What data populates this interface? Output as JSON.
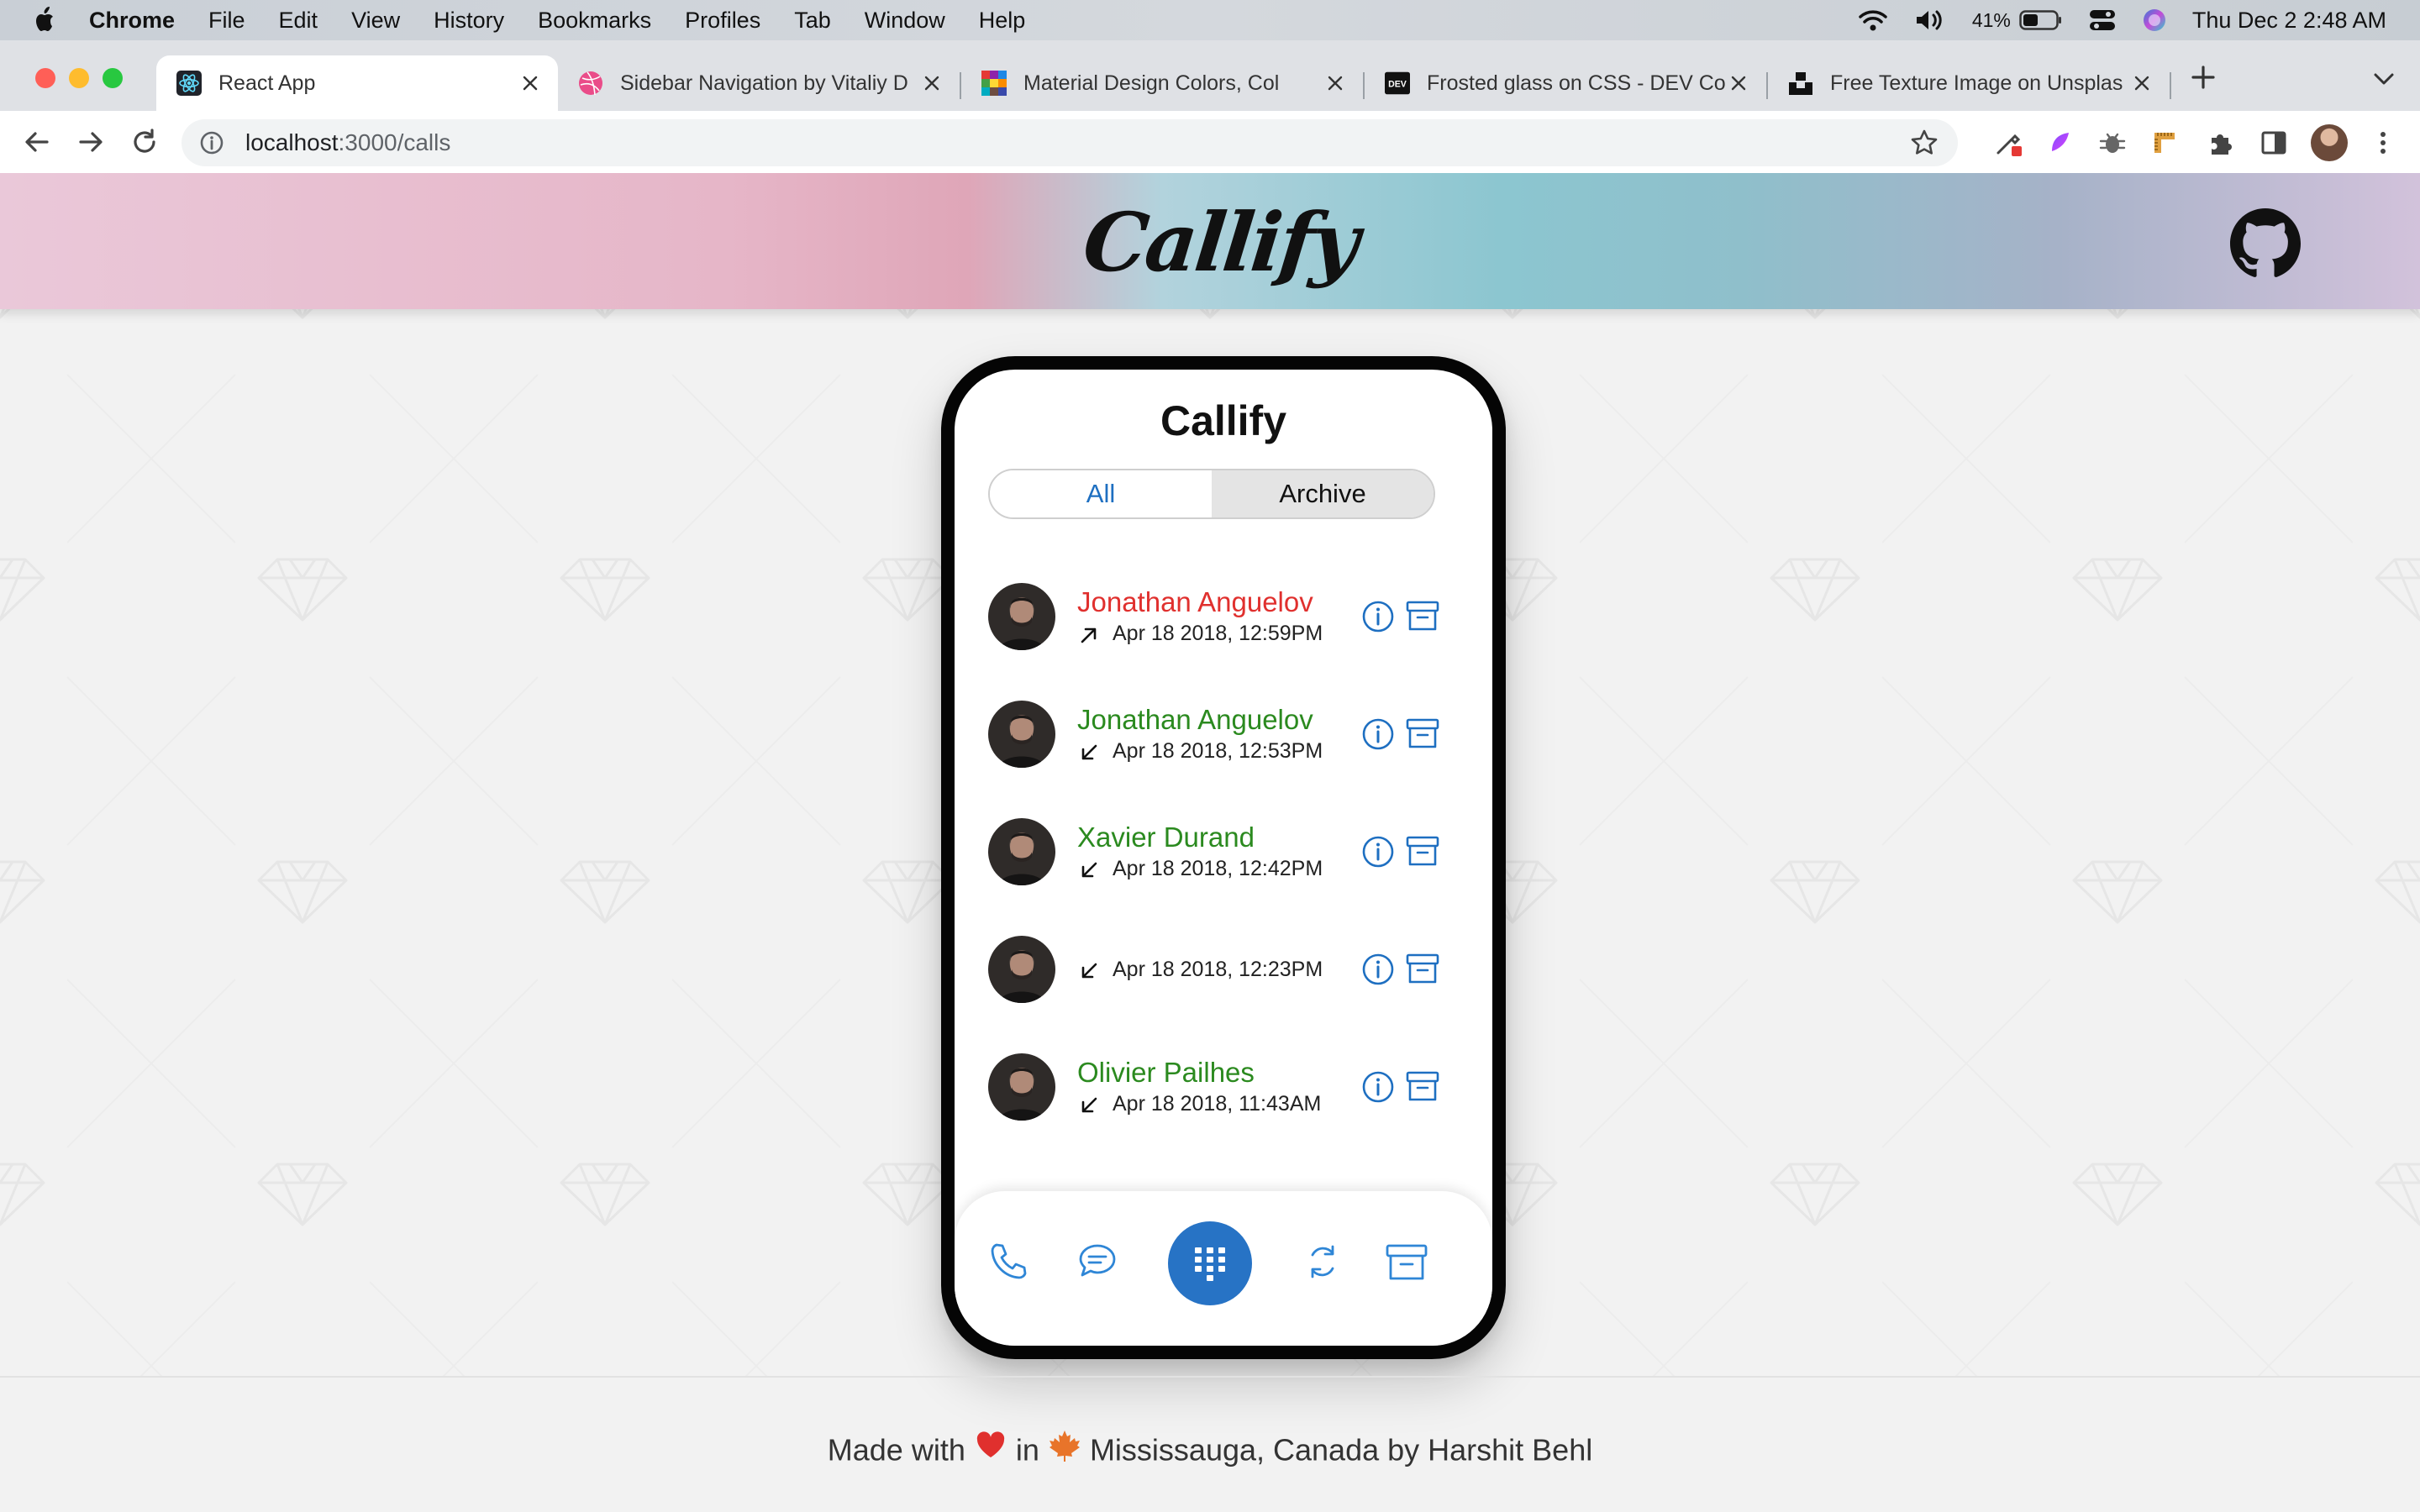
{
  "menubar": {
    "app_name": "Chrome",
    "items": [
      "File",
      "Edit",
      "View",
      "History",
      "Bookmarks",
      "Profiles",
      "Tab",
      "Window",
      "Help"
    ],
    "battery": "41%",
    "clock": "Thu Dec 2  2:48 AM"
  },
  "tabs": [
    {
      "title": "React App",
      "icon": "react-icon",
      "active": true
    },
    {
      "title": "Sidebar Navigation by Vitaliy D",
      "icon": "dribbble-icon",
      "active": false
    },
    {
      "title": "Material Design Colors, Col",
      "icon": "palette-icon",
      "active": false
    },
    {
      "title": "Frosted glass on CSS - DEV Co",
      "icon": "dev-icon",
      "active": false
    },
    {
      "title": "Free Texture Image on Unsplas",
      "icon": "unsplash-icon",
      "active": false
    }
  ],
  "omnibox": {
    "host": "localhost",
    "path": ":3000/calls"
  },
  "banner": {
    "logo": "Callify"
  },
  "phone": {
    "title": "Callify",
    "segments": {
      "all": "All",
      "archive": "Archive"
    },
    "calls": [
      {
        "name": "Jonathan Anguelov",
        "direction": "outbound",
        "time": "Apr 18 2018, 12:59PM"
      },
      {
        "name": "Jonathan Anguelov",
        "direction": "inbound",
        "time": "Apr 18 2018, 12:53PM"
      },
      {
        "name": "Xavier Durand",
        "direction": "inbound",
        "time": "Apr 18 2018, 12:42PM"
      },
      {
        "name": "",
        "direction": "inbound",
        "time": "Apr 18 2018, 12:23PM"
      },
      {
        "name": "Olivier Pailhes",
        "direction": "inbound",
        "time": "Apr 18 2018, 11:43AM"
      }
    ],
    "nav_icons": [
      "phone-icon",
      "chat-icon",
      "dialpad-icon",
      "refresh-icon",
      "archive-icon"
    ]
  },
  "footer": {
    "made_with": "Made with",
    "in": "in",
    "rest": "Mississauga, Canada by Harshit Behl"
  },
  "colors": {
    "accent_blue": "#1e6fc1",
    "outbound_red": "#e0302e",
    "inbound_green": "#2b8a1f"
  }
}
